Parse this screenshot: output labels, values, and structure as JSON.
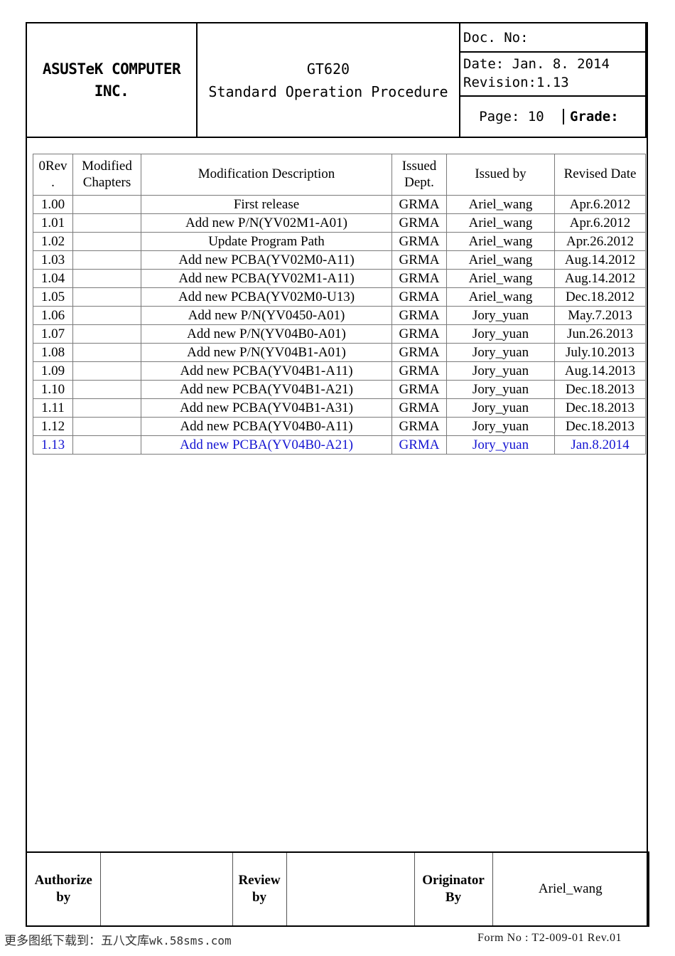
{
  "masthead": {
    "company": "ASUSTeK COMPUTER INC.",
    "company_line1": "ASUSTeK COMPUTER",
    "company_line2": "INC.",
    "title_line1": "GT620",
    "title_line2": "Standard Operation Procedure",
    "doc_no_label": "Doc. No:",
    "date_label": "Date: Jan. 8. 2014",
    "revision_label": "Revision:1.13",
    "page_label": "Page: 10",
    "grade_label": "Grade:"
  },
  "revision_table": {
    "headers": {
      "rev_line1": "0Rev",
      "rev_line2": ".",
      "chapters_line1": "Modified",
      "chapters_line2": "Chapters",
      "description": "Modification Description",
      "dept_line1": "Issued",
      "dept_line2": "Dept.",
      "issued_by": "Issued by",
      "revised_date": "Revised Date"
    },
    "rows": [
      {
        "rev": "1.00",
        "chapters": "",
        "description": "First release",
        "dept": "GRMA",
        "issued_by": "Ariel_wang",
        "date": "Apr.6.2012",
        "highlight": false
      },
      {
        "rev": "1.01",
        "chapters": "",
        "description": "Add new P/N(YV02M1-A01)",
        "dept": "GRMA",
        "issued_by": "Ariel_wang",
        "date": "Apr.6.2012",
        "highlight": false
      },
      {
        "rev": "1.02",
        "chapters": "",
        "description": "Update Program Path",
        "dept": "GRMA",
        "issued_by": "Ariel_wang",
        "date": "Apr.26.2012",
        "highlight": false
      },
      {
        "rev": "1.03",
        "chapters": "",
        "description": "Add new PCBA(YV02M0-A11)",
        "dept": "GRMA",
        "issued_by": "Ariel_wang",
        "date": "Aug.14.2012",
        "highlight": false
      },
      {
        "rev": "1.04",
        "chapters": "",
        "description": "Add new PCBA(YV02M1-A11)",
        "dept": "GRMA",
        "issued_by": "Ariel_wang",
        "date": "Aug.14.2012",
        "highlight": false
      },
      {
        "rev": "1.05",
        "chapters": "",
        "description": "Add new PCBA(YV02M0-U13)",
        "dept": "GRMA",
        "issued_by": "Ariel_wang",
        "date": "Dec.18.2012",
        "highlight": false
      },
      {
        "rev": "1.06",
        "chapters": "",
        "description": "Add new P/N(YV0450-A01)",
        "dept": "GRMA",
        "issued_by": "Jory_yuan",
        "date": "May.7.2013",
        "highlight": false
      },
      {
        "rev": "1.07",
        "chapters": "",
        "description": "Add new P/N(YV04B0-A01)",
        "dept": "GRMA",
        "issued_by": "Jory_yuan",
        "date": "Jun.26.2013",
        "highlight": false
      },
      {
        "rev": "1.08",
        "chapters": "",
        "description": "Add new P/N(YV04B1-A01)",
        "dept": "GRMA",
        "issued_by": "Jory_yuan",
        "date": "July.10.2013",
        "highlight": false
      },
      {
        "rev": "1.09",
        "chapters": "",
        "description": "Add new PCBA(YV04B1-A11)",
        "dept": "GRMA",
        "issued_by": "Jory_yuan",
        "date": "Aug.14.2013",
        "highlight": false
      },
      {
        "rev": "1.10",
        "chapters": "",
        "description": "Add new PCBA(YV04B1-A21)",
        "dept": "GRMA",
        "issued_by": "Jory_yuan",
        "date": "Dec.18.2013",
        "highlight": false
      },
      {
        "rev": "1.11",
        "chapters": "",
        "description": "Add new PCBA(YV04B1-A31)",
        "dept": "GRMA",
        "issued_by": "Jory_yuan",
        "date": "Dec.18.2013",
        "highlight": false
      },
      {
        "rev": "1.12",
        "chapters": "",
        "description": "Add new PCBA(YV04B0-A11)",
        "dept": "GRMA",
        "issued_by": "Jory_yuan",
        "date": "Dec.18.2013",
        "highlight": false
      },
      {
        "rev": "1.13",
        "chapters": "",
        "description": "Add new PCBA(YV04B0-A21)",
        "dept": "GRMA",
        "issued_by": "Jory_yuan",
        "date": "Jan.8.2014",
        "highlight": true
      }
    ],
    "highlight_color": "#1414d2"
  },
  "signature_table": {
    "authorize_label_line1": "Authorize",
    "authorize_label_line2": "by",
    "authorize_value": "",
    "review_label_line1": "Review",
    "review_label_line2": "by",
    "review_value": "",
    "originator_label_line1": "Originator",
    "originator_label_line2": "By",
    "originator_value": "Ariel_wang"
  },
  "footer": {
    "watermark_cjk": "更多图纸下载到：五八文库",
    "watermark_ascii": "wk.58sms.com",
    "form_no": "Form No : T2-009-01  Rev.01"
  }
}
